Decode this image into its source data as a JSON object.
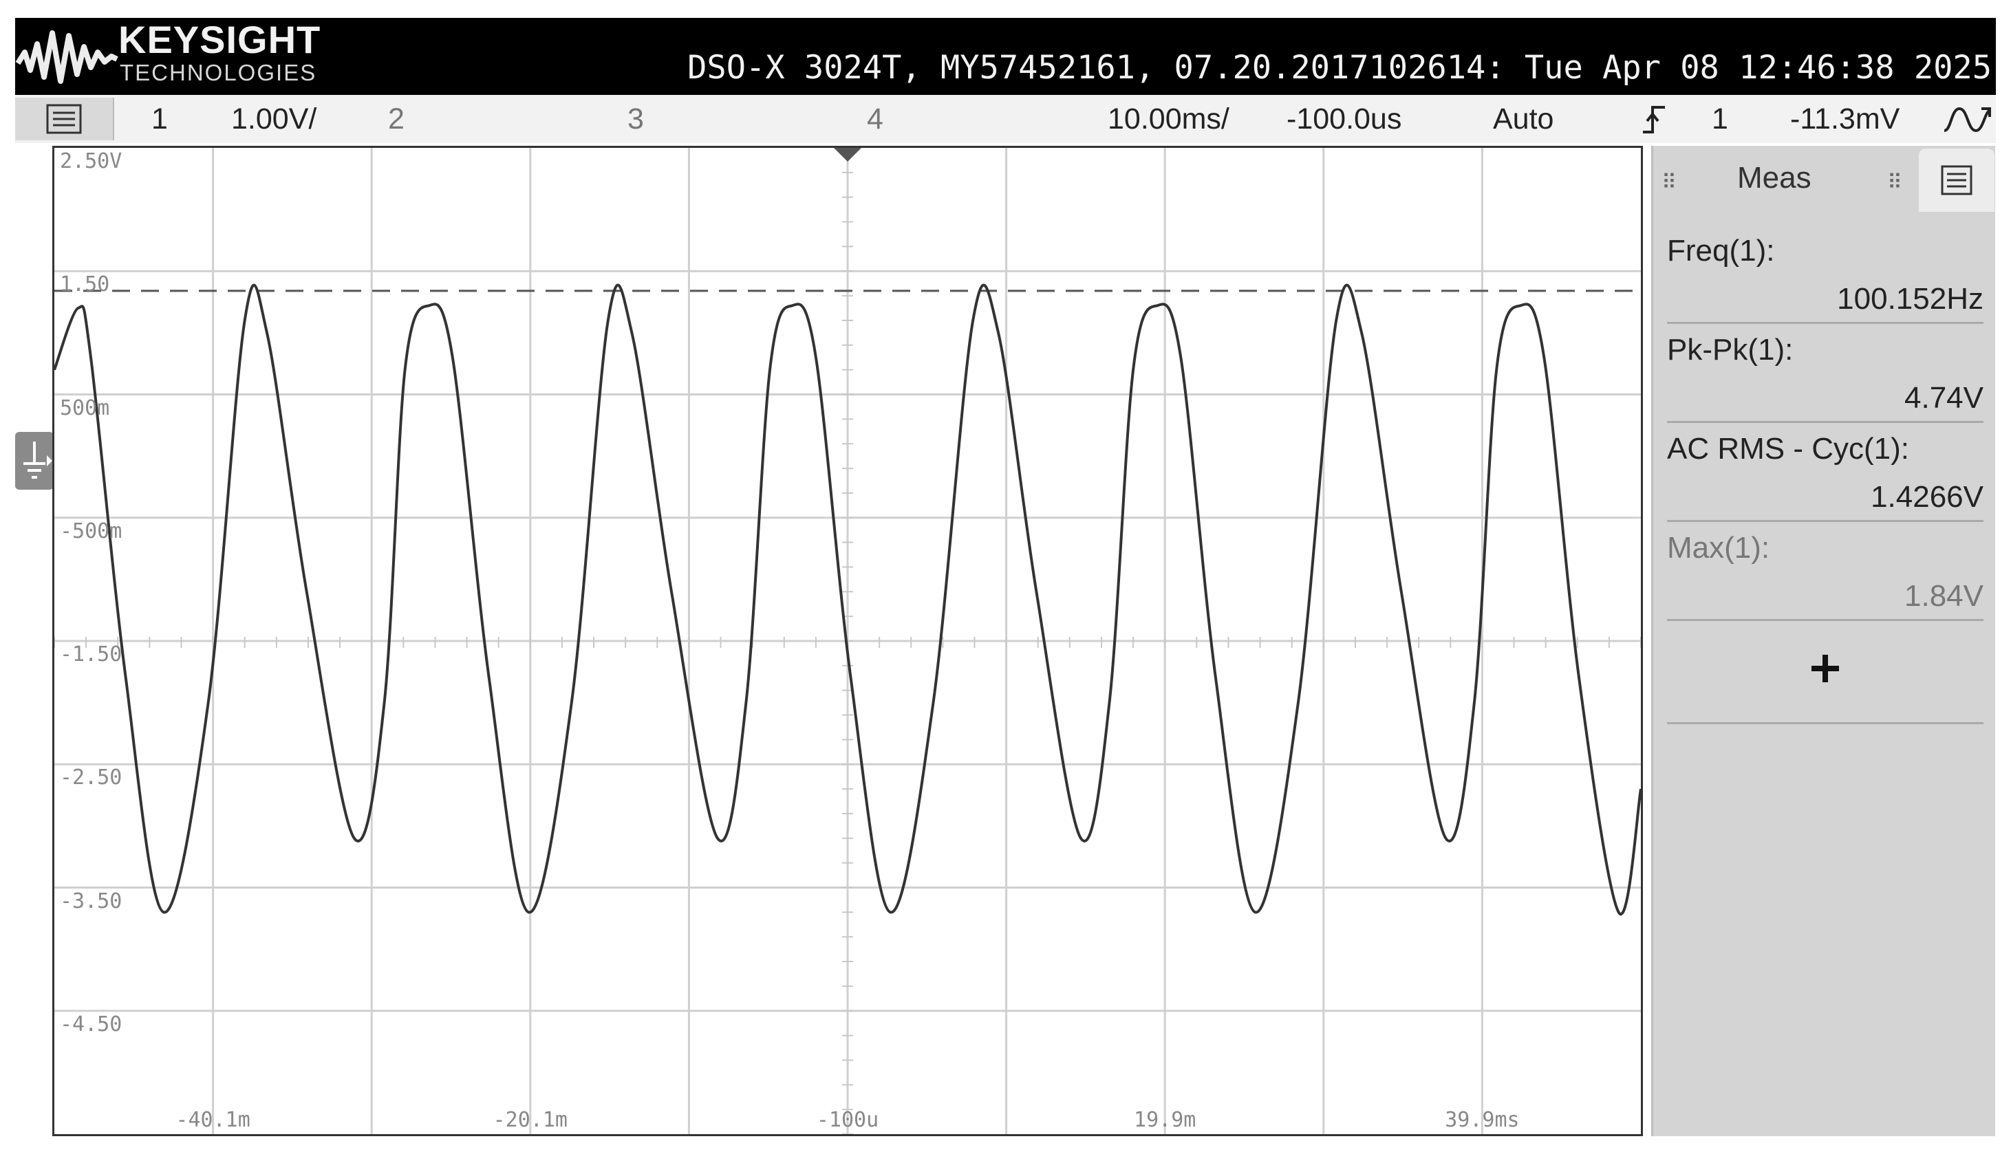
{
  "header": {
    "brand": "KEYSIGHT",
    "brand_sub": "TECHNOLOGIES",
    "scope_id": "DSO-X 3024T, MY57452161, 07.20.2017102614: Tue Apr 08 12:46:38 2025"
  },
  "settings_bar": {
    "ch1_num": "1",
    "ch1_scale": "1.00V/",
    "ch2_num": "2",
    "ch3_num": "3",
    "ch4_num": "4",
    "timebase": "10.00ms/",
    "delay": "-100.0us",
    "trigger_mode": "Auto",
    "trigger_source": "1",
    "trigger_level": "-11.3mV"
  },
  "graticule": {
    "volt_labels": [
      "2.50V",
      "1.50",
      "500m",
      "-500m",
      "-1.50",
      "-2.50",
      "-3.50",
      "-4.50"
    ],
    "time_labels": [
      "-40.1m",
      "-20.1m",
      "-100u",
      "19.9m",
      "39.9ms"
    ]
  },
  "measurements": {
    "tab_label": "Meas",
    "items": [
      {
        "label": "Freq(1):",
        "value": "100.152Hz"
      },
      {
        "label": "Pk-Pk(1):",
        "value": "4.74V"
      },
      {
        "label": "AC RMS - Cyc(1):",
        "value": "1.4266V"
      },
      {
        "label": "Max(1):",
        "value": "1.84V"
      }
    ]
  },
  "chart_data": {
    "type": "line",
    "title": "",
    "xlabel": "",
    "ylabel": "",
    "x_unit": "s",
    "y_unit": "V",
    "xlim": [
      -0.0501,
      0.0499
    ],
    "ylim": [
      -5.0,
      3.0
    ],
    "grid": true,
    "trigger_level_line": 1.84,
    "series": [
      {
        "frequency_hz": 100.152,
        "pk_pk_v": 4.74,
        "max_v": 1.84,
        "offset_v": -0.53,
        "points": [
          [
            -0.0501,
            1.2
          ],
          [
            -0.0486,
            1.7
          ],
          [
            -0.0478,
            1.3
          ],
          [
            -0.0456,
            -1.3
          ],
          [
            -0.0432,
            -3.2
          ],
          [
            -0.0404,
            -1.5
          ],
          [
            -0.0381,
            1.6
          ],
          [
            -0.0367,
            1.5
          ],
          [
            -0.0342,
            -0.6
          ],
          [
            -0.0312,
            -2.6
          ],
          [
            -0.0293,
            -1.5
          ],
          [
            -0.028,
            1.2
          ],
          [
            -0.0265,
            1.72
          ],
          [
            -0.025,
            1.3
          ],
          [
            -0.0227,
            -1.3
          ],
          [
            -0.0202,
            -3.2
          ],
          [
            -0.0175,
            -1.5
          ],
          [
            -0.0152,
            1.6
          ],
          [
            -0.0137,
            1.5
          ],
          [
            -0.0112,
            -0.6
          ],
          [
            -0.0083,
            -2.6
          ],
          [
            -0.0065,
            -1.5
          ],
          [
            -0.005,
            1.2
          ],
          [
            -0.0036,
            1.72
          ],
          [
            -0.0021,
            1.3
          ],
          [
            0.0001,
            -1.3
          ],
          [
            0.0026,
            -3.2
          ],
          [
            0.0053,
            -1.5
          ],
          [
            0.0078,
            1.6
          ],
          [
            0.0094,
            1.5
          ],
          [
            0.0118,
            -0.6
          ],
          [
            0.0146,
            -2.6
          ],
          [
            0.0164,
            -1.5
          ],
          [
            0.0179,
            1.2
          ],
          [
            0.0194,
            1.72
          ],
          [
            0.0209,
            1.3
          ],
          [
            0.0231,
            -1.3
          ],
          [
            0.0256,
            -3.2
          ],
          [
            0.0283,
            -1.5
          ],
          [
            0.0307,
            1.6
          ],
          [
            0.0323,
            1.5
          ],
          [
            0.0348,
            -0.6
          ],
          [
            0.0376,
            -2.6
          ],
          [
            0.0394,
            -1.5
          ],
          [
            0.0408,
            1.2
          ],
          [
            0.0423,
            1.72
          ],
          [
            0.0438,
            1.3
          ],
          [
            0.046,
            -1.3
          ],
          [
            0.0485,
            -3.2
          ],
          [
            0.0499,
            -2.2
          ]
        ]
      }
    ]
  }
}
